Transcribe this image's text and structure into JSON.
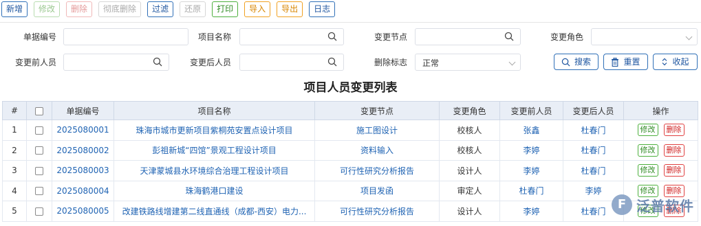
{
  "toolbar": {
    "new": "新增",
    "edit": "修改",
    "delete": "删除",
    "purge": "彻底删除",
    "filter": "过滤",
    "restore": "还原",
    "print": "打印",
    "import": "导入",
    "export": "导出",
    "log": "日志"
  },
  "filters": {
    "doc_no_label": "单据编号",
    "project_label": "项目名称",
    "node_label": "变更节点",
    "role_label": "变更角色",
    "before_label": "变更前人员",
    "after_label": "变更后人员",
    "delflag_label": "删除标志",
    "delflag_value": "正常"
  },
  "actions": {
    "search": "搜索",
    "reset": "重置",
    "collapse": "收起"
  },
  "list_title": "项目人员变更列表",
  "table": {
    "headers": [
      "#",
      "",
      "单据编号",
      "项目名称",
      "变更节点",
      "变更角色",
      "变更前人员",
      "变更后人员",
      "操作"
    ],
    "op_edit": "修改",
    "op_delete": "删除",
    "rows": [
      {
        "idx": "1",
        "no": "2025080001",
        "project": "珠海市城市更新项目紫桐苑安置点设计项目",
        "node": "施工图设计",
        "role": "校核人",
        "before": "张鑫",
        "after": "杜春门"
      },
      {
        "idx": "2",
        "no": "2025080002",
        "project": "彭祖新城“四馆”景观工程设计项目",
        "node": "资料输入",
        "role": "校核人",
        "before": "李婷",
        "after": "杜春门"
      },
      {
        "idx": "3",
        "no": "2025080003",
        "project": "天津蒙城县水环境综合治理工程设计项目",
        "node": "可行性研究分析报告",
        "role": "设计人",
        "before": "李婷",
        "after": "杜春门"
      },
      {
        "idx": "4",
        "no": "2025080004",
        "project": "珠海鹤港口建设",
        "node": "项目发函",
        "role": "审定人",
        "before": "杜春门",
        "after": "李婷"
      },
      {
        "idx": "5",
        "no": "2025080005",
        "project": "改建铁路线增建第二线直通线（成都-西安）电力...",
        "node": "可行性研究分析报告",
        "role": "设计人",
        "before": "李婷",
        "after": "杜春门"
      }
    ]
  },
  "watermark": {
    "text": "泛普软件"
  },
  "colors": {
    "accent": "#1f56a0",
    "link": "#1f63b3",
    "edit": "#2e8b22",
    "delete": "#d02020",
    "header_bg": "#e9eef6"
  }
}
